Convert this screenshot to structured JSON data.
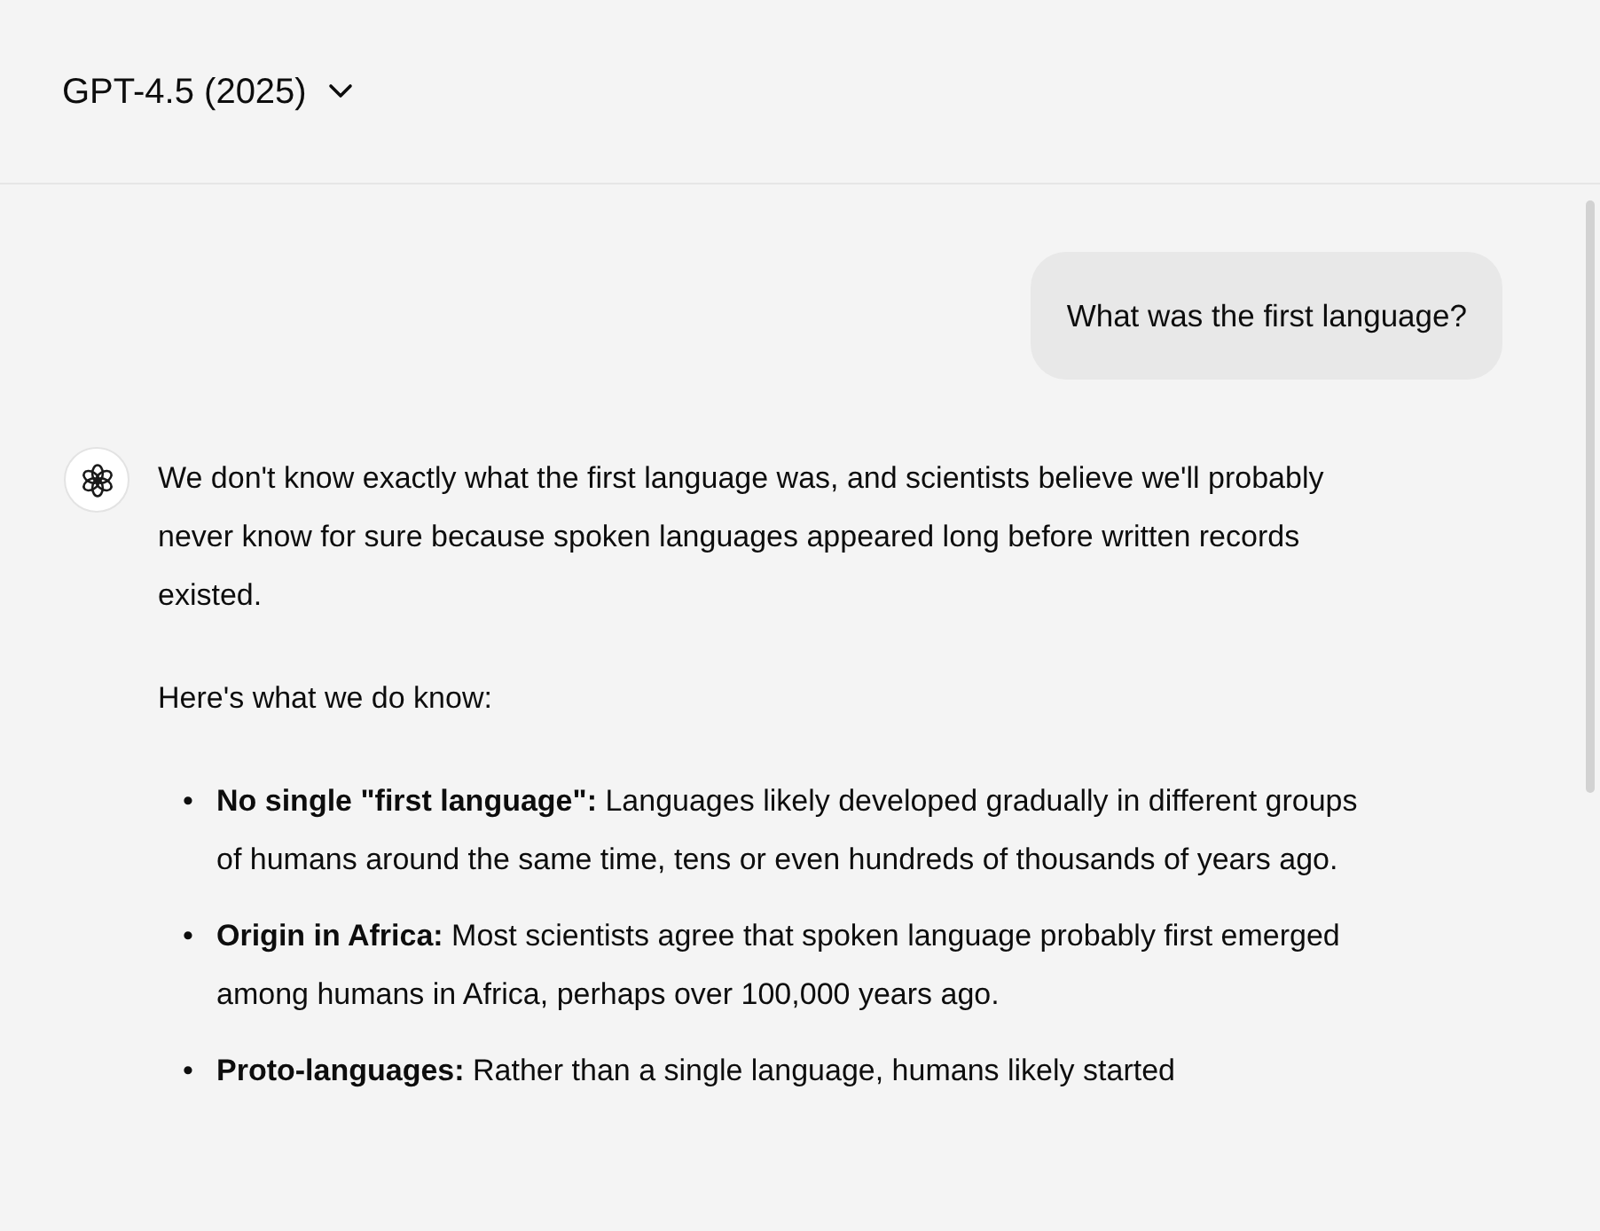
{
  "header": {
    "model_name": "GPT-4.5 (2025)"
  },
  "messages": [
    {
      "kind": "user",
      "text": "What was the first language?"
    },
    {
      "kind": "assistant",
      "paragraphs": [
        "We don't know exactly what the first language was, and scientists believe we'll probably never know for sure because spoken languages appeared long before written records existed.",
        "Here's what we do know:"
      ],
      "bullets": [
        {
          "marker": "•",
          "text": "**No single \"first language\":** Languages likely developed gradually in different groups of humans around the same time, tens or even hundreds of thousands of years ago."
        },
        {
          "marker": "•",
          "text": "**Origin in Africa:** Most scientists agree that spoken language probably first emerged among humans in Africa, perhaps over 100,000 years ago."
        },
        {
          "marker": "•",
          "text": "**Proto-languages:** Rather than a single language, humans likely started"
        }
      ]
    }
  ]
}
